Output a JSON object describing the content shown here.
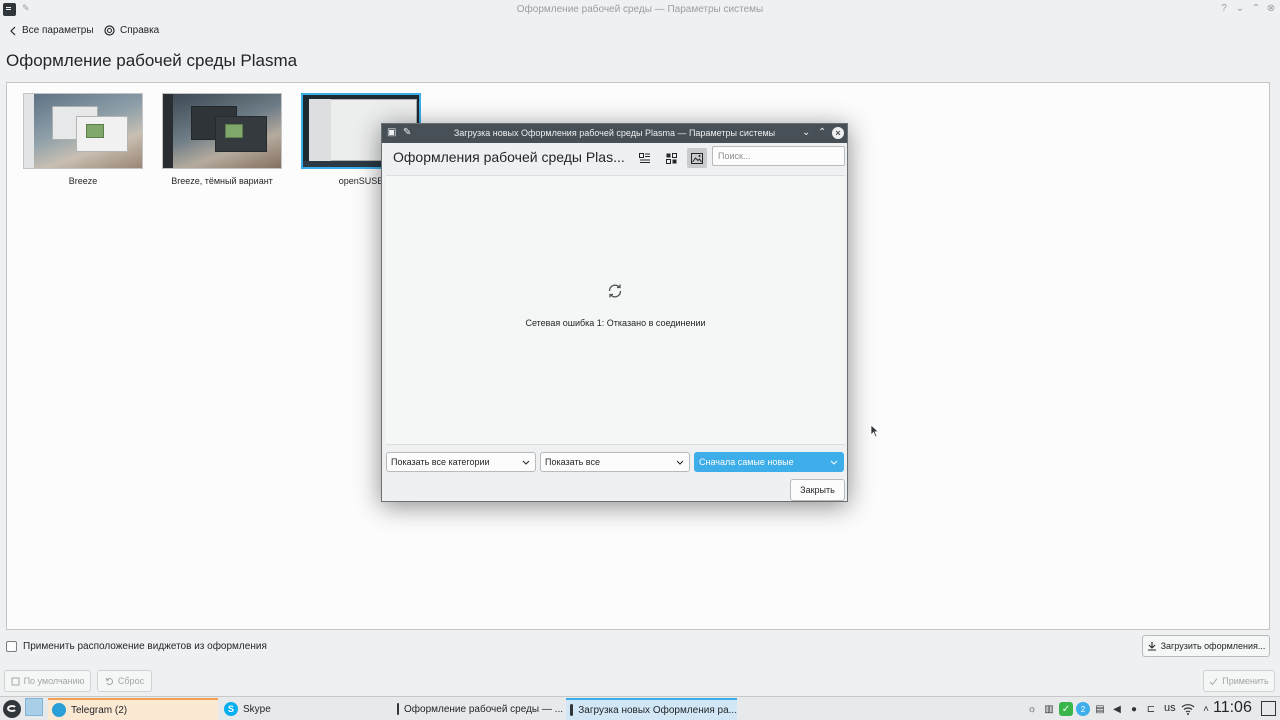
{
  "main_window": {
    "title": "Оформление рабочей среды — Параметры системы",
    "help_symbol": "?",
    "toolbar": {
      "all_settings": "Все параметры",
      "help": "Справка"
    },
    "page_title": "Оформление рабочей среды Plasma",
    "themes": [
      {
        "label": "Breeze"
      },
      {
        "label": "Breeze, тёмный вариант"
      },
      {
        "label": "openSUSE"
      }
    ],
    "apply_layout_checkbox": "Применить расположение виджетов из оформления",
    "download_button": "Загрузить оформления...",
    "defaults_button": "По умолчанию",
    "reset_button": "Сброс",
    "apply_button": "Применить"
  },
  "dialog": {
    "title": "Загрузка новых Оформления рабочей среды Plasma — Параметры системы",
    "header_title": "Оформления рабочей среды Plas...",
    "search_placeholder": "Поиск...",
    "error_message": "Сетевая ошибка 1: Отказано в соединении",
    "category_combo": "Показать все категории",
    "filter_combo": "Показать все",
    "sort_combo": "Сначала самые новые",
    "close_button": "Закрыть",
    "accent_color": "#3daee9"
  },
  "taskbar": {
    "tasks": [
      {
        "label": "Telegram (2)"
      },
      {
        "label": "Skype"
      },
      {
        "label": "Оформление рабочей среды — ..."
      },
      {
        "label": "Загрузка новых Оформления ра..."
      }
    ],
    "badge": "2",
    "keyboard_layout": "us",
    "clock": "11:06"
  }
}
